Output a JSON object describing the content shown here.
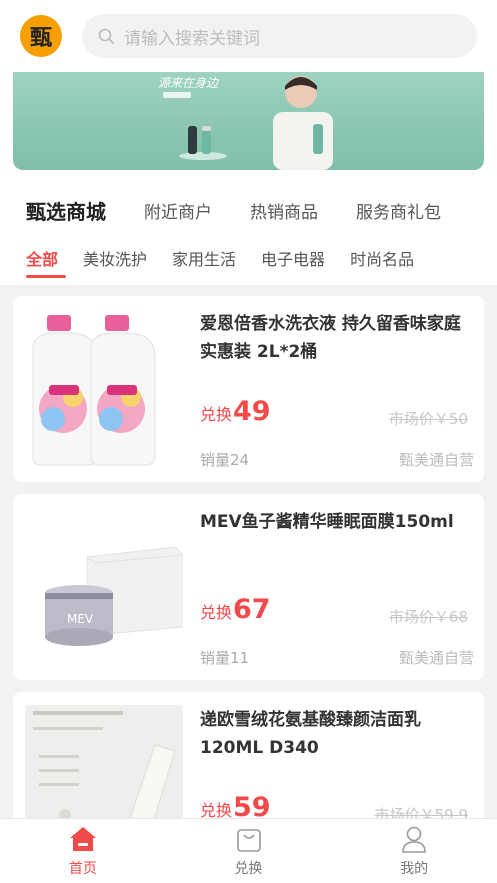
{
  "header": {
    "logo_char": "甄",
    "search_placeholder": "请输入搜索关键词"
  },
  "banner": {
    "slogan": "源来在身边",
    "brand_color": "#8ac6b2"
  },
  "main_tabs": [
    "甄选商城",
    "附近商户",
    "热销商品",
    "服务商礼包"
  ],
  "sub_tabs": [
    "全部",
    "美妆洗护",
    "家用生活",
    "电子电器",
    "时尚名品"
  ],
  "products": [
    {
      "title": "爱恩倍香水洗衣液 持久留香味家庭实惠装 2L*2桶",
      "price_prefix": "兑换",
      "price": "49",
      "market_price": "市场价￥50",
      "sales": "销量24",
      "shop": "甄美通自营"
    },
    {
      "title": "MEV鱼子酱精华睡眠面膜150ml",
      "price_prefix": "兑换",
      "price": "67",
      "market_price": "市场价￥68",
      "sales": "销量11",
      "shop": "甄美通自营"
    },
    {
      "title": "递欧雪绒花氨基酸臻颜洁面乳120ML D340",
      "price_prefix": "兑换",
      "price": "59",
      "market_price": "市场价￥59.9",
      "sales": "",
      "shop": ""
    }
  ],
  "bottom_nav": [
    {
      "label": "首页",
      "icon": "home-icon",
      "active": true
    },
    {
      "label": "兑换",
      "icon": "bag-icon",
      "active": false
    },
    {
      "label": "我的",
      "icon": "user-icon",
      "active": false
    }
  ],
  "colors": {
    "accent": "#f24a4a",
    "logo_bg": "#f5a000"
  }
}
